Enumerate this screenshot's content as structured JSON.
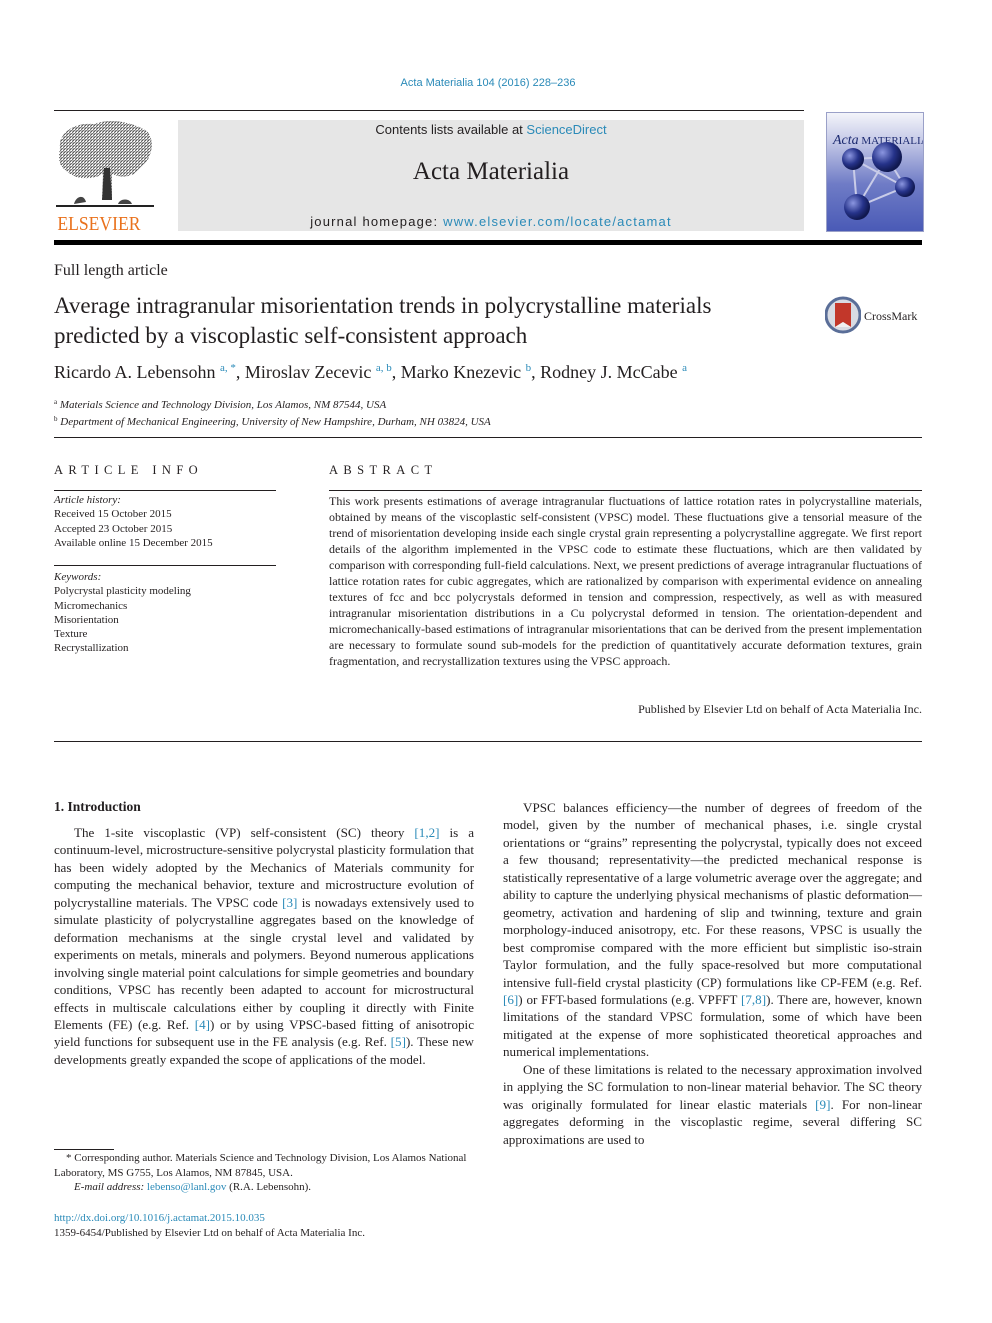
{
  "header": {
    "citation": "Acta Materialia 104 (2016) 228–236",
    "contents_prefix": "Contents lists available at ",
    "contents_link": "ScienceDirect",
    "journal_title": "Acta Materialia",
    "homepage_prefix": "journal homepage: ",
    "homepage_link": "www.elsevier.com/locate/actamat",
    "publisher_logo_text": "ELSEVIER",
    "cover_title_italic": "Acta",
    "cover_title_rest": " MATERIALIA",
    "colors": {
      "link": "#2a8ab8",
      "elsevier_orange": "#e9711c",
      "masthead_bg": "#e6e6e6"
    }
  },
  "article": {
    "type": "Full length article",
    "title": "Average intragranular misorientation trends in polycrystalline materials predicted by a viscoplastic self-consistent approach",
    "crossmark_label": "CrossMark",
    "authors": [
      {
        "name": "Ricardo A. Lebensohn",
        "sup": "a, *",
        "sep": ", "
      },
      {
        "name": "Miroslav Zecevic",
        "sup": "a, b",
        "sep": ", "
      },
      {
        "name": "Marko Knezevic",
        "sup": "b",
        "sep": ", "
      },
      {
        "name": "Rodney J. McCabe",
        "sup": "a",
        "sep": ""
      }
    ],
    "affiliations": [
      {
        "mark": "a",
        "text": "Materials Science and Technology Division, Los Alamos, NM 87544, USA"
      },
      {
        "mark": "b",
        "text": "Department of Mechanical Engineering, University of New Hampshire, Durham, NH 03824, USA"
      }
    ]
  },
  "article_info": {
    "heading": "ARTICLE INFO",
    "history_label": "Article history:",
    "history": [
      "Received 15 October 2015",
      "Accepted 23 October 2015",
      "Available online 15 December 2015"
    ],
    "keywords_label": "Keywords:",
    "keywords": [
      "Polycrystal plasticity modeling",
      "Micromechanics",
      "Misorientation",
      "Texture",
      "Recrystallization"
    ]
  },
  "abstract": {
    "heading": "ABSTRACT",
    "text": "This work presents estimations of average intragranular fluctuations of lattice rotation rates in poly­crystalline materials, obtained by means of the viscoplastic self-consistent (VPSC) model. These fluctu­ations give a tensorial measure of the trend of misorientation developing inside each single crystal grain representing a polycrystalline aggregate. We first report details of the algorithm implemented in the VPSC code to estimate these fluctuations, which are then validated by comparison with corresponding full-field calculations. Next, we present predictions of average intragranular fluctuations of lattice rotation rates for cubic aggregates, which are rationalized by comparison with experimental evidence on annealing textures of fcc and bcc polycrystals deformed in tension and compression, respectively, as well as with measured intragranular misorientation distributions in a Cu polycrystal deformed in tension. The orientation-dependent and micromechanically-based estimations of intragranular misorientations that can be derived from the present implementation are necessary to formulate sound sub-models for the prediction of quantitatively accurate deformation textures, grain fragmentation, and recrystallization textures using the VPSC approach.",
    "published_by": "Published by Elsevier Ltd on behalf of Acta Materialia Inc."
  },
  "body": {
    "section_heading": "1.  Introduction",
    "left_paragraphs": [
      [
        {
          "t": "The 1-site viscoplastic (VP) self-consistent (SC) theory "
        },
        {
          "t": "[1,2]",
          "link": true
        },
        {
          "t": " is a continuum-level, microstructure-sensitive polycrystal plasticity formulation that has been widely adopted by the Mechanics of Materials community for computing the mechanical behavior, texture and microstructure evolution of polycrystalline materials. The VPSC code "
        },
        {
          "t": "[3]",
          "link": true
        },
        {
          "t": " is nowadays extensively used to simulate plas­ticity of polycrystalline aggregates based on the knowledge of deformation mechanisms at the single crystal level and validated by experiments on metals, minerals and polymers. Beyond numerous applications involving single material point calculations for simple geometries and boundary conditions, VPSC has recently been adapted to account for microstructural effects in multiscale calcu­lations either by coupling it directly with Finite Elements (FE) (e.g. Ref. "
        },
        {
          "t": "[4]",
          "link": true
        },
        {
          "t": ") or by using VPSC-based fitting of anisotropic yield functions for subsequent use in the FE analysis (e.g. Ref. "
        },
        {
          "t": "[5]",
          "link": true
        },
        {
          "t": "). These new de­velopments greatly expanded the scope of applications of the model."
        }
      ]
    ],
    "right_paragraphs": [
      [
        {
          "t": "VPSC balances efficiency—the number of degrees of freedom of the model, given by the number of mechanical phases, i.e. single crystal orientations or “grains” representing the polycrystal, typi­cally does not exceed a few thousand; representativity—the pre­dicted mechanical response is statistically representative of a large volumetric average over the aggregate; and ability to capture the underlying physical mechanisms of plastic deformation—geom­etry, activation and hardening of slip and twinning, texture and grain morphology-induced anisotropy, etc. For these reasons, VPSC is usually the best compromise compared with the more efficient but simplistic iso-strain Taylor formulation, and the fully space-resolved but more computational intensive full-field crystal plas­ticity (CP) formulations like CP-FEM (e.g. Ref. "
        },
        {
          "t": "[6]",
          "link": true
        },
        {
          "t": ") or FFT-based formulations (e.g. VPFFT "
        },
        {
          "t": "[7,8]",
          "link": true
        },
        {
          "t": "). There are, however, known limita­tions of the standard VPSC formulation, some of which have been mitigated at the expense of more sophisticated theoretical ap­proaches and numerical implementations."
        }
      ],
      [
        {
          "t": "One of these limitations is related to the necessary approxima­tion involved in applying the SC formulation to non-linear material behavior. The SC theory was originally formulated for linear elastic materials "
        },
        {
          "t": "[9]",
          "link": true
        },
        {
          "t": ". For non-linear aggregates deforming in the visco­plastic regime, several differing SC approximations are used to"
        }
      ]
    ]
  },
  "footnotes": {
    "corresponding": "* Corresponding author. Materials Science and Technology Division, Los Alamos National Laboratory, MS G755, Los Alamos, NM 87845, USA.",
    "email_label": "E-mail address: ",
    "email": "lebenso@lanl.gov",
    "email_suffix": " (R.A. Lebensohn).",
    "doi": "http://dx.doi.org/10.1016/j.actamat.2015.10.035",
    "issn_line": "1359-6454/Published by Elsevier Ltd on behalf of Acta Materialia Inc."
  }
}
